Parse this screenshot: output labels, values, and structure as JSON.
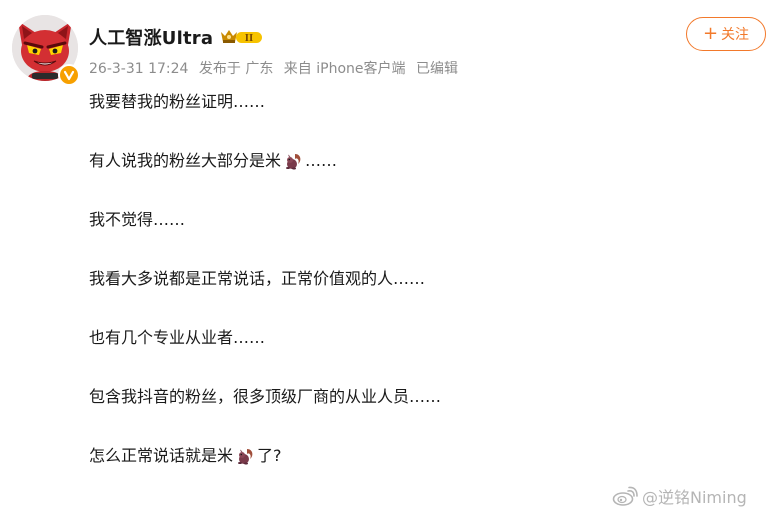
{
  "user": {
    "name": "人工智涨Ultra",
    "vip_level": "II",
    "avatar_icon": "red-devil-cat-avatar-icon",
    "verified_icon": "orange-verified-v-icon"
  },
  "meta": {
    "date": "26-3-31 17:24",
    "location": "发布于 广东",
    "source": "来自 iPhone客户端",
    "edited": "已编辑"
  },
  "follow": {
    "plus": "+",
    "label": "关注"
  },
  "post": {
    "line1": "我要替我的粉丝证明……",
    "line2_before": "有人说我的粉丝大部分是米",
    "line2_after": "……",
    "line3": "我不觉得……",
    "line4": "我看大多说都是正常说话，正常价值观的人……",
    "line5": "也有几个专业从业者……",
    "line6": "包含我抖音的粉丝，很多顶级厂商的从业人员……",
    "line7_before": "怎么正常说话就是米",
    "line7_after": "了?"
  },
  "emoji_icon": "squirrel-emoji-icon",
  "watermark": {
    "text": "@逆铭Niming",
    "icon": "weibo-logo-icon"
  },
  "colors": {
    "follow_accent": "#f2792b",
    "meta_text": "#8c8c8c",
    "badge_orange": "#f7a000"
  }
}
